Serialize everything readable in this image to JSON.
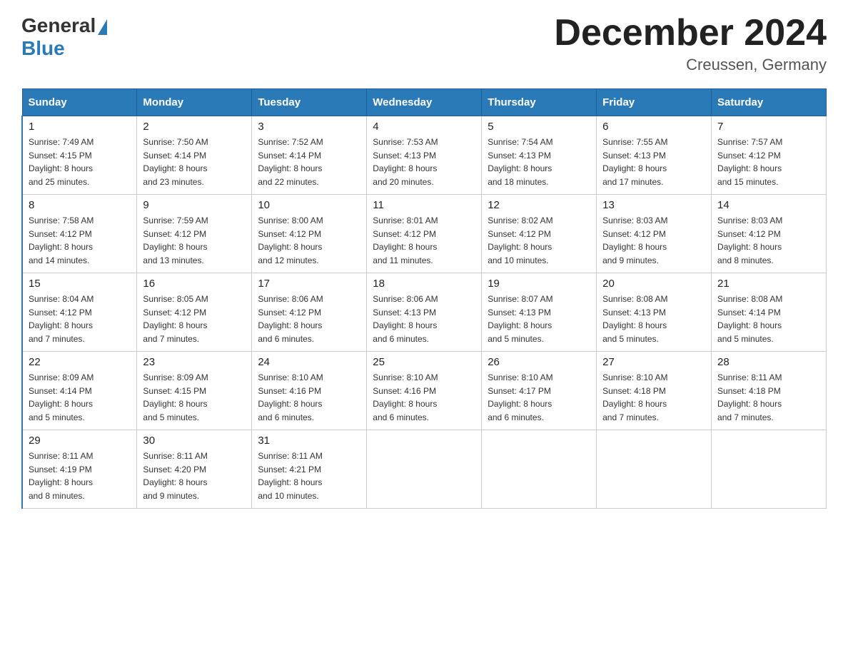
{
  "header": {
    "logo_line1": "General",
    "logo_line2": "Blue",
    "month_year": "December 2024",
    "location": "Creussen, Germany"
  },
  "days_of_week": [
    "Sunday",
    "Monday",
    "Tuesday",
    "Wednesday",
    "Thursday",
    "Friday",
    "Saturday"
  ],
  "weeks": [
    [
      {
        "day": "1",
        "sunrise": "7:49 AM",
        "sunset": "4:15 PM",
        "daylight": "8 hours and 25 minutes."
      },
      {
        "day": "2",
        "sunrise": "7:50 AM",
        "sunset": "4:14 PM",
        "daylight": "8 hours and 23 minutes."
      },
      {
        "day": "3",
        "sunrise": "7:52 AM",
        "sunset": "4:14 PM",
        "daylight": "8 hours and 22 minutes."
      },
      {
        "day": "4",
        "sunrise": "7:53 AM",
        "sunset": "4:13 PM",
        "daylight": "8 hours and 20 minutes."
      },
      {
        "day": "5",
        "sunrise": "7:54 AM",
        "sunset": "4:13 PM",
        "daylight": "8 hours and 18 minutes."
      },
      {
        "day": "6",
        "sunrise": "7:55 AM",
        "sunset": "4:13 PM",
        "daylight": "8 hours and 17 minutes."
      },
      {
        "day": "7",
        "sunrise": "7:57 AM",
        "sunset": "4:12 PM",
        "daylight": "8 hours and 15 minutes."
      }
    ],
    [
      {
        "day": "8",
        "sunrise": "7:58 AM",
        "sunset": "4:12 PM",
        "daylight": "8 hours and 14 minutes."
      },
      {
        "day": "9",
        "sunrise": "7:59 AM",
        "sunset": "4:12 PM",
        "daylight": "8 hours and 13 minutes."
      },
      {
        "day": "10",
        "sunrise": "8:00 AM",
        "sunset": "4:12 PM",
        "daylight": "8 hours and 12 minutes."
      },
      {
        "day": "11",
        "sunrise": "8:01 AM",
        "sunset": "4:12 PM",
        "daylight": "8 hours and 11 minutes."
      },
      {
        "day": "12",
        "sunrise": "8:02 AM",
        "sunset": "4:12 PM",
        "daylight": "8 hours and 10 minutes."
      },
      {
        "day": "13",
        "sunrise": "8:03 AM",
        "sunset": "4:12 PM",
        "daylight": "8 hours and 9 minutes."
      },
      {
        "day": "14",
        "sunrise": "8:03 AM",
        "sunset": "4:12 PM",
        "daylight": "8 hours and 8 minutes."
      }
    ],
    [
      {
        "day": "15",
        "sunrise": "8:04 AM",
        "sunset": "4:12 PM",
        "daylight": "8 hours and 7 minutes."
      },
      {
        "day": "16",
        "sunrise": "8:05 AM",
        "sunset": "4:12 PM",
        "daylight": "8 hours and 7 minutes."
      },
      {
        "day": "17",
        "sunrise": "8:06 AM",
        "sunset": "4:12 PM",
        "daylight": "8 hours and 6 minutes."
      },
      {
        "day": "18",
        "sunrise": "8:06 AM",
        "sunset": "4:13 PM",
        "daylight": "8 hours and 6 minutes."
      },
      {
        "day": "19",
        "sunrise": "8:07 AM",
        "sunset": "4:13 PM",
        "daylight": "8 hours and 5 minutes."
      },
      {
        "day": "20",
        "sunrise": "8:08 AM",
        "sunset": "4:13 PM",
        "daylight": "8 hours and 5 minutes."
      },
      {
        "day": "21",
        "sunrise": "8:08 AM",
        "sunset": "4:14 PM",
        "daylight": "8 hours and 5 minutes."
      }
    ],
    [
      {
        "day": "22",
        "sunrise": "8:09 AM",
        "sunset": "4:14 PM",
        "daylight": "8 hours and 5 minutes."
      },
      {
        "day": "23",
        "sunrise": "8:09 AM",
        "sunset": "4:15 PM",
        "daylight": "8 hours and 5 minutes."
      },
      {
        "day": "24",
        "sunrise": "8:10 AM",
        "sunset": "4:16 PM",
        "daylight": "8 hours and 6 minutes."
      },
      {
        "day": "25",
        "sunrise": "8:10 AM",
        "sunset": "4:16 PM",
        "daylight": "8 hours and 6 minutes."
      },
      {
        "day": "26",
        "sunrise": "8:10 AM",
        "sunset": "4:17 PM",
        "daylight": "8 hours and 6 minutes."
      },
      {
        "day": "27",
        "sunrise": "8:10 AM",
        "sunset": "4:18 PM",
        "daylight": "8 hours and 7 minutes."
      },
      {
        "day": "28",
        "sunrise": "8:11 AM",
        "sunset": "4:18 PM",
        "daylight": "8 hours and 7 minutes."
      }
    ],
    [
      {
        "day": "29",
        "sunrise": "8:11 AM",
        "sunset": "4:19 PM",
        "daylight": "8 hours and 8 minutes."
      },
      {
        "day": "30",
        "sunrise": "8:11 AM",
        "sunset": "4:20 PM",
        "daylight": "8 hours and 9 minutes."
      },
      {
        "day": "31",
        "sunrise": "8:11 AM",
        "sunset": "4:21 PM",
        "daylight": "8 hours and 10 minutes."
      },
      null,
      null,
      null,
      null
    ]
  ]
}
